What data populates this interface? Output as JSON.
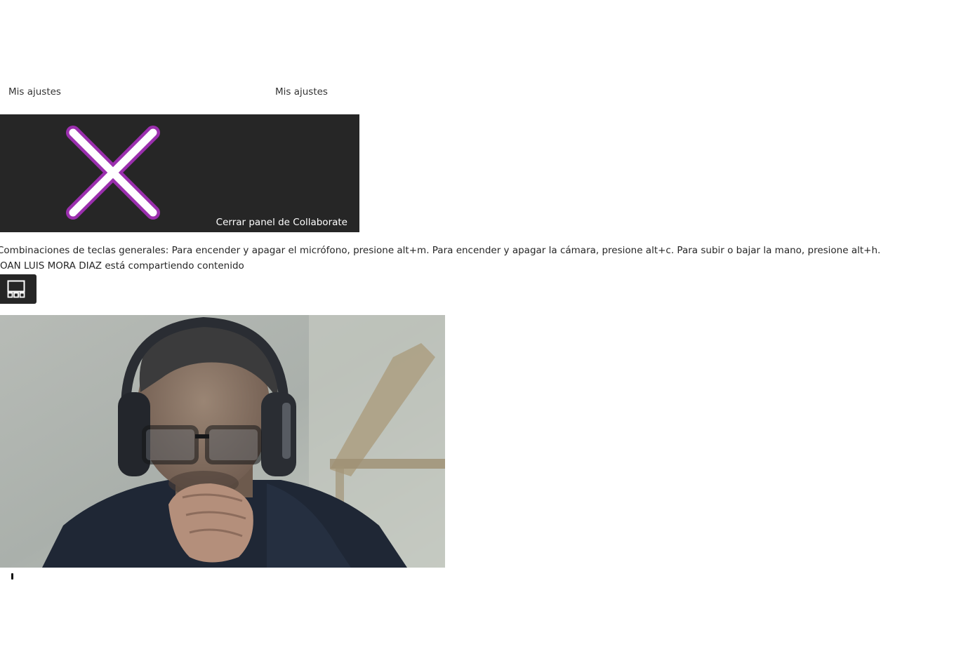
{
  "settings": {
    "left_label": "Mis ajustes",
    "right_label": "Mis ajustes"
  },
  "close_panel": {
    "label": "Cerrar panel de Collaborate",
    "icon": "close-x-icon",
    "icon_color": "#9b2fae",
    "background": "#262626"
  },
  "shortcuts": {
    "text": "Combinaciones de teclas generales: Para encender y apagar el micrófono, presione alt+m. Para encender y apagar la cámara, presione alt+c. Para subir o bajar la mano, presione alt+h."
  },
  "sharing": {
    "text": "JOAN LUIS MORA DIAZ está compartiendo contenido"
  },
  "layout_button": {
    "icon": "layout-grid-icon"
  },
  "video": {
    "icon": "participant-video"
  }
}
